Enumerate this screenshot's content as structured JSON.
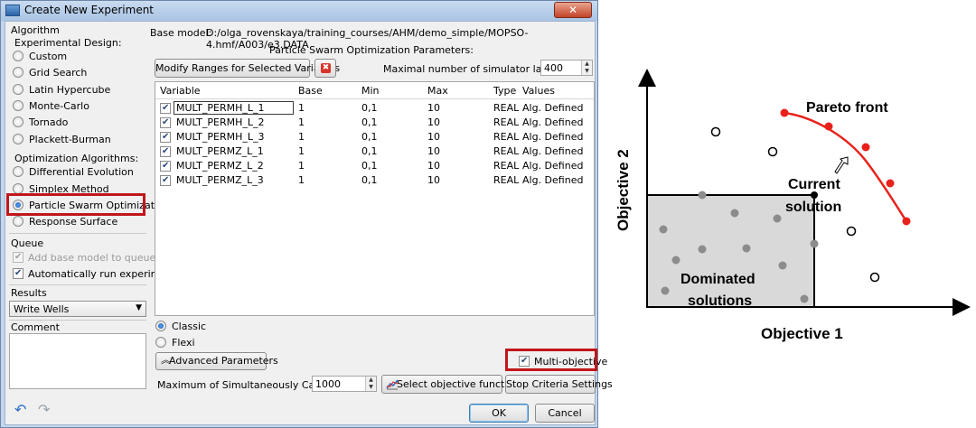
{
  "window": {
    "title": "Create New Experiment",
    "close_glyph": "✕"
  },
  "algorithm": {
    "group_label": "Algorithm",
    "experimental_design_label": "Experimental Design:",
    "design_options": [
      "Custom",
      "Grid Search",
      "Latin Hypercube",
      "Monte-Carlo",
      "Tornado",
      "Plackett-Burman"
    ],
    "optimization_label": "Optimization Algorithms:",
    "optimization_options": [
      "Differential Evolution",
      "Simplex Method",
      "Particle Swarm Optimization",
      "Response Surface"
    ],
    "selected": "Particle Swarm Optimization"
  },
  "queue": {
    "group_label": "Queue",
    "add_base_model": "Add base model to queue",
    "auto_run": "Automatically run experiment"
  },
  "results": {
    "group_label": "Results",
    "selected_value": "Write Wells",
    "arrow": "▼"
  },
  "comment": {
    "group_label": "Comment"
  },
  "base_model": {
    "label": "Base model:",
    "path": "D:/olga_rovenskaya/training_courses/AHM/demo_simple/MOPSO-4.hmf/A003/e3.DATA"
  },
  "pso": {
    "title": "Particle Swarm Optimization Parameters:",
    "modify_ranges_button": "Modify Ranges for Selected Variables",
    "delete_icon_glyph": "✖",
    "max_launches_label": "Maximal number of simulator launches:",
    "max_launches_value": "400"
  },
  "table": {
    "columns": [
      "Variable",
      "Base",
      "Min",
      "Max",
      "Type",
      "Values"
    ],
    "rows": [
      [
        "MULT_PERMH_L_1",
        "1",
        "0,1",
        "10",
        "REAL",
        "Alg. Defined"
      ],
      [
        "MULT_PERMH_L_2",
        "1",
        "0,1",
        "10",
        "REAL",
        "Alg. Defined"
      ],
      [
        "MULT_PERMH_L_3",
        "1",
        "0,1",
        "10",
        "REAL",
        "Alg. Defined"
      ],
      [
        "MULT_PERMZ_L_1",
        "1",
        "0,1",
        "10",
        "REAL",
        "Alg. Defined"
      ],
      [
        "MULT_PERMZ_L_2",
        "1",
        "0,1",
        "10",
        "REAL",
        "Alg. Defined"
      ],
      [
        "MULT_PERMZ_L_3",
        "1",
        "0,1",
        "10",
        "REAL",
        "Alg. Defined"
      ]
    ]
  },
  "mode": {
    "classic": "Classic",
    "flexi": "Flexi",
    "selected": "Classic"
  },
  "advanced_button": "Advanced Parameters",
  "multi_objective": {
    "label": "Multi-objective",
    "checked": true
  },
  "max_simultaneous": {
    "label": "Maximum of Simultaneously Calculated",
    "value": "1000"
  },
  "select_objective_button": "Select objective function",
  "stop_criteria_button": "Stop Criteria Settings",
  "ok_button": "OK",
  "cancel_button": "Cancel",
  "diagram": {
    "x_axis_label": "Objective 1",
    "y_axis_label": "Objective 2",
    "pareto_label": "Pareto front",
    "current_solution_label_1": "Current",
    "current_solution_label_2": "solution",
    "dominated_label_1": "Dominated",
    "dominated_label_2": "solutions",
    "pareto_color": "#e8211a",
    "dominated_fill": "#d9d9d9",
    "point_color": "#8c8c8c"
  }
}
